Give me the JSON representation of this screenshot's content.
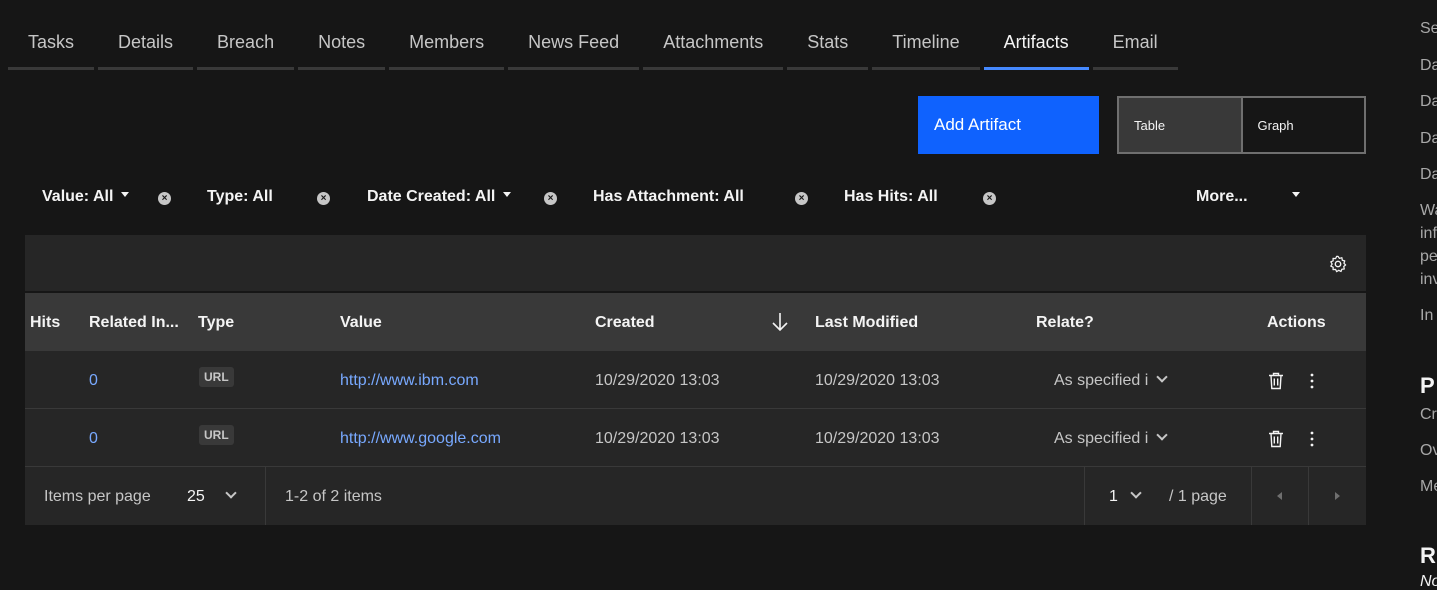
{
  "tabs": [
    "Tasks",
    "Details",
    "Breach",
    "Notes",
    "Members",
    "News Feed",
    "Attachments",
    "Stats",
    "Timeline",
    "Artifacts",
    "Email"
  ],
  "active_tab": "Artifacts",
  "toolbar": {
    "add_label": "Add Artifact",
    "view_table": "Table",
    "view_graph": "Graph",
    "accent_color": "#0f62fe"
  },
  "filters": {
    "value": "Value: All",
    "type": "Type: All",
    "date_created": "Date Created: All",
    "has_attachment": "Has Attachment: All",
    "has_hits": "Has Hits: All",
    "more": "More..."
  },
  "table": {
    "headers": {
      "hits": "Hits",
      "related": "Related In...",
      "type": "Type",
      "value": "Value",
      "created": "Created",
      "last_modified": "Last Modified",
      "relate": "Relate?",
      "actions": "Actions"
    },
    "rows": [
      {
        "related": "0",
        "type": "URL",
        "value": "http://www.ibm.com",
        "created": "10/29/2020 13:03",
        "last_modified": "10/29/2020 13:03",
        "relate": "As specified i"
      },
      {
        "related": "0",
        "type": "URL",
        "value": "http://www.google.com",
        "created": "10/29/2020 13:03",
        "last_modified": "10/29/2020 13:03",
        "relate": "As specified i"
      }
    ]
  },
  "pagination": {
    "items_per_page_label": "Items per page",
    "items_per_page": "25",
    "range": "1-2 of 2 items",
    "page": "1",
    "page_total": "/ 1 page"
  },
  "side_panel": {
    "lines": [
      "Se",
      "Da",
      "Da",
      "Da",
      "Da",
      "Wa",
      "inf",
      "pe",
      "inv",
      "In"
    ],
    "heading_p": "P",
    "lines_p": [
      "Cr",
      "Ov",
      "Me"
    ],
    "heading_r": "R",
    "line_r": "No"
  }
}
